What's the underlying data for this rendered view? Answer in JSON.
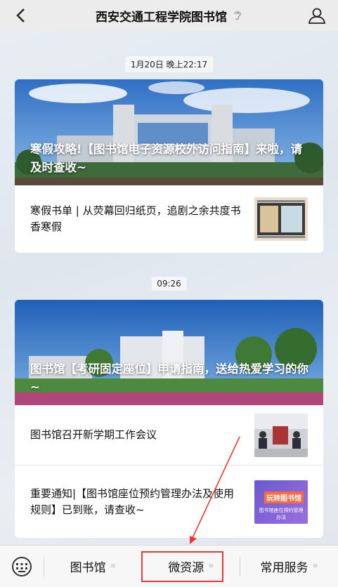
{
  "header": {
    "back_icon": "chevron-left-icon",
    "title": "西安交通工程学院图书馆",
    "title_icon": "ear-icon",
    "profile_icon": "person-icon"
  },
  "messages": [
    {
      "timestamp": "1月20日 晚上22:17",
      "main_article": {
        "title": "寒假攻略!【图书馆电子资源校外访问指南】来啦，请及时查收~"
      },
      "sub_articles": [
        {
          "title": "寒假书单 | 从荧幕回归纸页，追剧之余共度书香寒假"
        }
      ]
    },
    {
      "timestamp": "09:26",
      "main_article": {
        "title": "图书馆【考研固定座位】申请指南，送给热爱学习的你~"
      },
      "sub_articles": [
        {
          "title": "图书馆召开新学期工作会议"
        },
        {
          "title": "重要通知|【图书馆座位预约管理办法及使用规则】已到账，请查收~"
        }
      ]
    }
  ],
  "thumbnails": {
    "booklist_banner": "",
    "reservation_banner_title": "玩转图书馆",
    "reservation_banner_sub": "图书馆座位预约管理办法"
  },
  "bottom_menu": {
    "keyboard_icon": "keyboard-icon",
    "items": [
      {
        "label": "图书馆",
        "icon": "menu-dots-icon"
      },
      {
        "label": "微资源",
        "icon": "menu-dots-icon"
      },
      {
        "label": "常用服务",
        "icon": "menu-dots-icon"
      }
    ]
  },
  "annotation": {
    "highlight_color": "#e53935",
    "highlighted_item": "微资源"
  }
}
